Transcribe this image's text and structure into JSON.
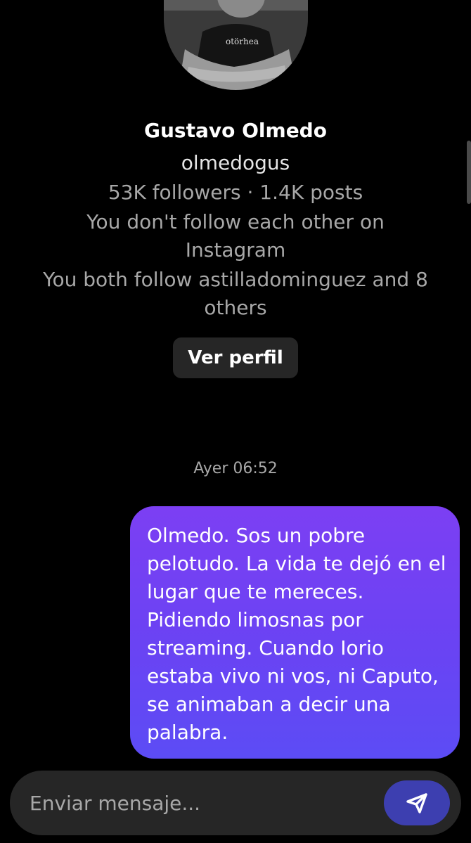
{
  "profile": {
    "name": "Gustavo Olmedo",
    "username": "olmedogus",
    "stats": "53K followers · 1.4K posts",
    "follow_status": "You don't follow each other on Instagram",
    "mutual": "You both follow astilladominguez and 8 others",
    "view_profile_label": "Ver perfil"
  },
  "conversation": {
    "timestamp": "Ayer 06:52",
    "messages": [
      {
        "text": "Olmedo. Sos un pobre pelotudo. La vida te dejó en el lugar que te mereces. Pidiendo limosnas por streaming. Cuando Iorio estaba vivo ni vos, ni Caputo, se animaban a decir una palabra."
      }
    ]
  },
  "composer": {
    "placeholder": "Enviar mensaje...",
    "send_icon": "send-icon"
  },
  "colors": {
    "background": "#000000",
    "bubble_top": "#7c3ff3",
    "bubble_bottom": "#5c4cf5",
    "send_button": "#3d3fb0",
    "composer_bg": "#262626"
  }
}
